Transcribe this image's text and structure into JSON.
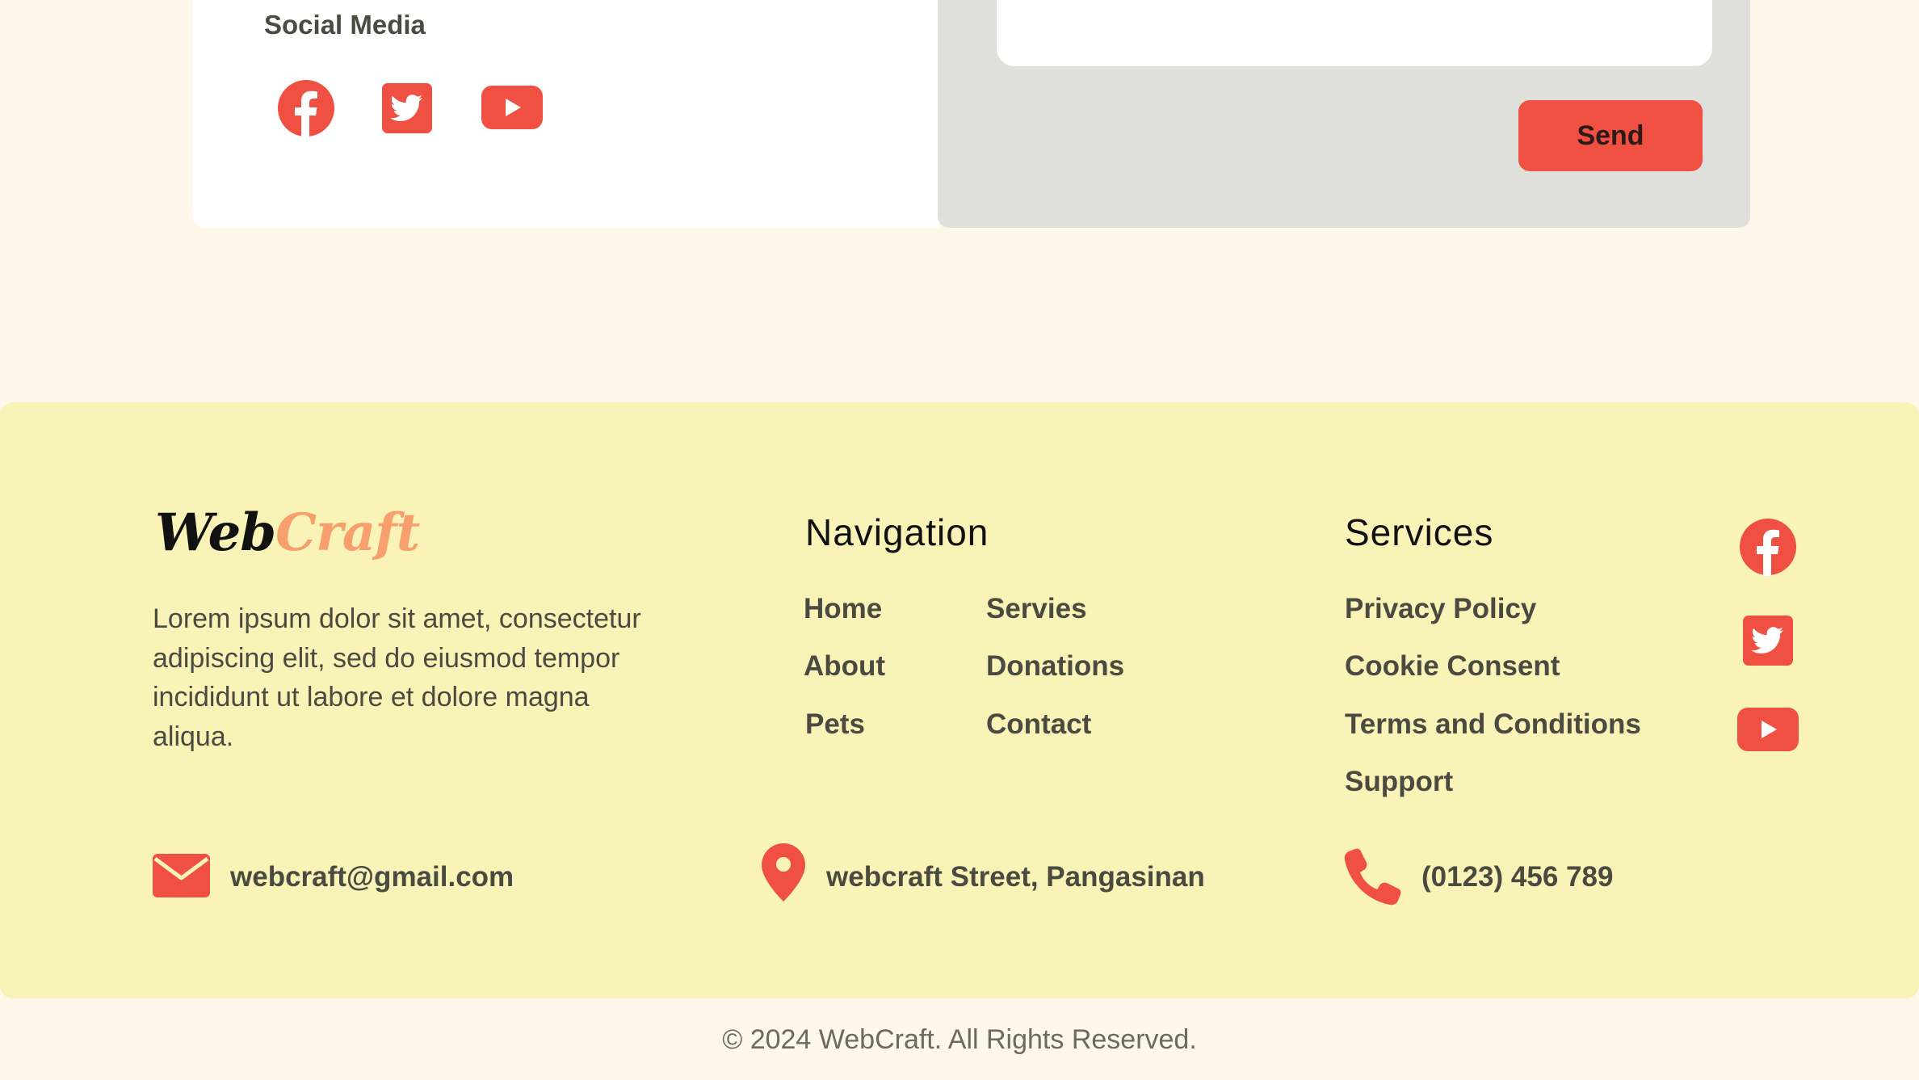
{
  "contact": {
    "social_title": "Social Media",
    "send_label": "Send"
  },
  "footer": {
    "logo_part1": "Web",
    "logo_part2": "Craft",
    "about": "Lorem ipsum dolor sit amet, consectetur adipiscing elit, sed do eiusmod tempor incididunt ut labore et dolore magna aliqua.",
    "navigation": {
      "heading": "Navigation",
      "links": [
        "Home",
        "Servies",
        "About",
        "Donations",
        "Pets",
        "Contact"
      ]
    },
    "services": {
      "heading": "Services",
      "links": [
        "Privacy Policy",
        "Cookie Consent",
        "Terms and Conditions",
        "Support"
      ]
    },
    "email": "webcraft@gmail.com",
    "address": "webcraft Street, Pangasinan",
    "phone": "(0123) 456 789",
    "copyright": "© 2024 WebCraft. All Rights Reserved."
  },
  "colors": {
    "accent": "#ef5041",
    "footer_bg": "#faf3b7",
    "page_bg": "#fff8ea",
    "logo_craft": "#f7a06e"
  },
  "icons": [
    "facebook-icon",
    "twitter-icon",
    "youtube-icon",
    "envelope-icon",
    "map-pin-icon",
    "phone-icon"
  ]
}
